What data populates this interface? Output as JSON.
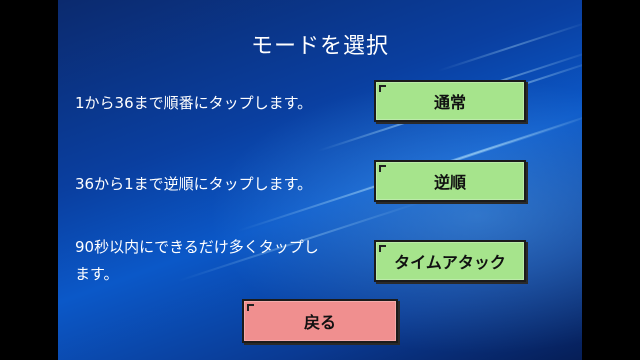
{
  "title": "モードを選択",
  "modes": [
    {
      "description": "1から36まで順番にタップします。",
      "button_label": "通常"
    },
    {
      "description": "36から1まで逆順にタップします。",
      "button_label": "逆順"
    },
    {
      "description_line1": "90秒以内にできるだけ多くタップし",
      "description_line2": "ます。",
      "button_label": "タイムアタック"
    }
  ],
  "back_label": "戻る",
  "colors": {
    "button_green": "#a6e48c",
    "button_red": "#f08f8f",
    "background_blue": "#0a3fa0"
  }
}
